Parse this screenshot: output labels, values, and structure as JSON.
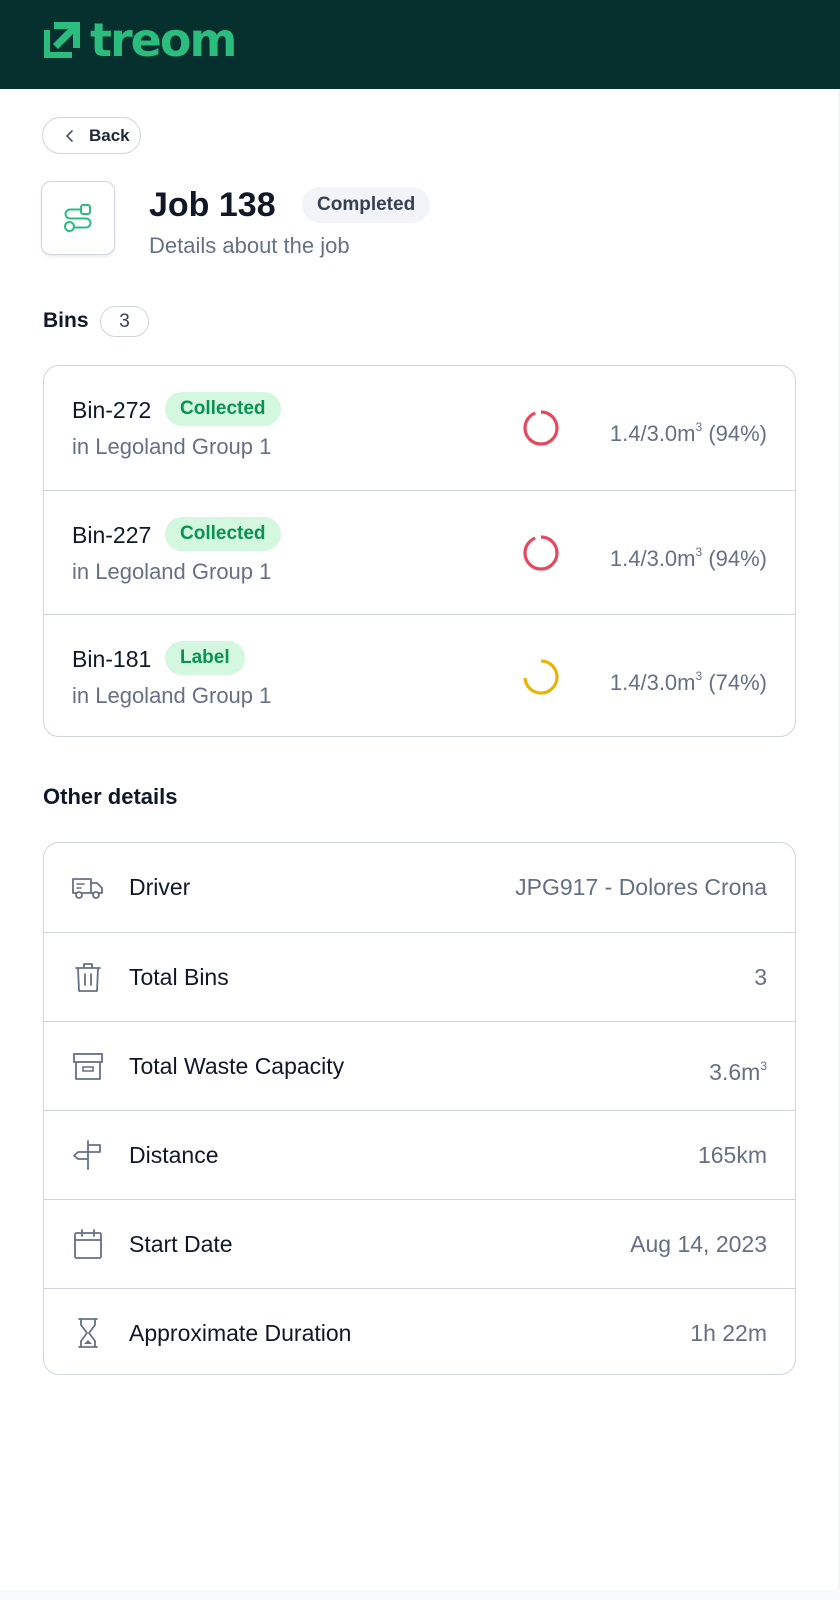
{
  "brand": {
    "name": "treom",
    "icon": "arrow-up-right-square-icon",
    "color": "#2bbd7e",
    "header_bg": "#06302e"
  },
  "back": {
    "label": "Back",
    "icon": "chevron-left-icon"
  },
  "job": {
    "title": "Job 138",
    "status": "Completed",
    "subtitle": "Details about the job",
    "icon": "route-icon"
  },
  "bins": {
    "label": "Bins",
    "count": "3",
    "items": [
      {
        "name": "Bin-272",
        "badge": "Collected",
        "location": "in Legoland Group 1",
        "fill_text": "1.4/3.0m",
        "fill_sup": "3",
        "fill_percent_text": "(94%)",
        "fill_percent": 94,
        "gauge_color": "#e5485f"
      },
      {
        "name": "Bin-227",
        "badge": "Collected",
        "location": "in Legoland Group 1",
        "fill_text": "1.4/3.0m",
        "fill_sup": "3",
        "fill_percent_text": "(94%)",
        "fill_percent": 94,
        "gauge_color": "#e5485f"
      },
      {
        "name": "Bin-181",
        "badge": "Label",
        "location": "in Legoland Group 1",
        "fill_text": "1.4/3.0m",
        "fill_sup": "3",
        "fill_percent_text": "(74%)",
        "fill_percent": 74,
        "gauge_color": "#e9b308"
      }
    ]
  },
  "other": {
    "label": "Other details",
    "rows": [
      {
        "icon": "truck-icon",
        "label": "Driver",
        "value": "JPG917 - Dolores Crona",
        "sup": ""
      },
      {
        "icon": "trash-bin-icon",
        "label": "Total Bins",
        "value": "3",
        "sup": ""
      },
      {
        "icon": "archive-box-icon",
        "label": "Total Waste Capacity",
        "value": "3.6m",
        "sup": "3"
      },
      {
        "icon": "signpost-icon",
        "label": "Distance",
        "value": "165km",
        "sup": ""
      },
      {
        "icon": "calendar-icon",
        "label": "Start Date",
        "value": "Aug 14, 2023",
        "sup": ""
      },
      {
        "icon": "hourglass-icon",
        "label": "Approximate Duration",
        "value": "1h 22m",
        "sup": ""
      }
    ]
  }
}
